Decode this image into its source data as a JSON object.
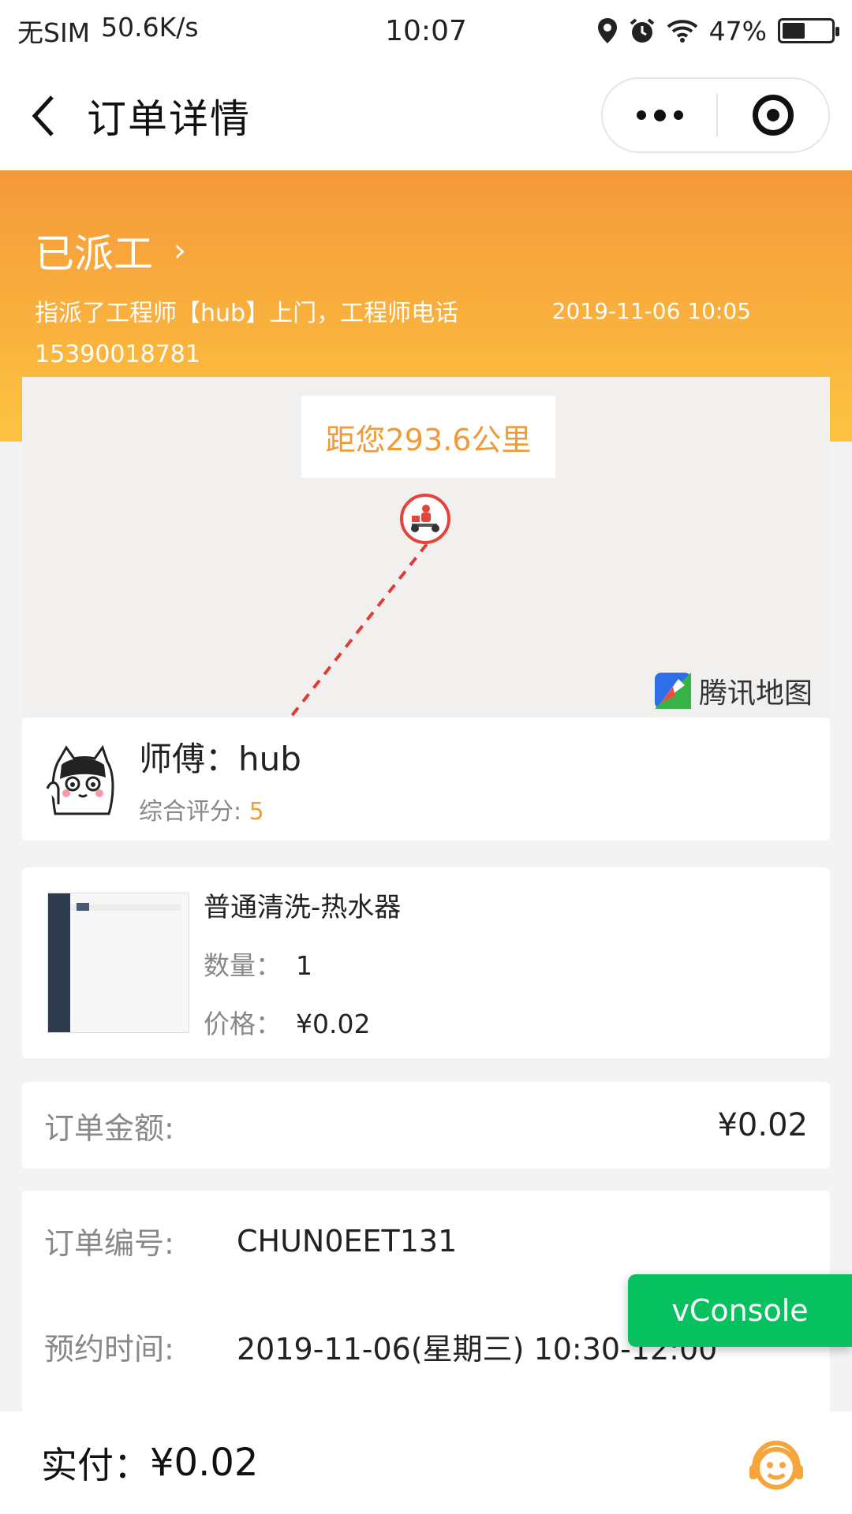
{
  "status_bar": {
    "carrier": "无SIM",
    "speed": "50.6K/s",
    "time": "10:07",
    "battery": "47%",
    "battery_level": 0.47
  },
  "nav": {
    "title": "订单详情",
    "icons": [
      "back-arrow-icon",
      "more-icon",
      "target-icon"
    ]
  },
  "order_status": {
    "title": "已派工",
    "message": "指派了工程师【hub】上门，工程师电话15390018781",
    "time": "2019-11-06 10:05"
  },
  "map": {
    "distance": "距您293.6公里",
    "provider": "腾讯地图",
    "route_color": "#e23b33"
  },
  "worker": {
    "name": "师傅：hub",
    "rating_label": "综合评分: ",
    "rating_value": "5"
  },
  "product": {
    "name": "普通清洗-热水器",
    "quantity_label": "数量：",
    "quantity": "1",
    "price_label": "价格：",
    "price": "¥0.02"
  },
  "amount": {
    "label": "订单金额:",
    "value": "¥0.02"
  },
  "order_info": {
    "number_label": "订单编号:",
    "number": "CHUN0EET131",
    "time_label": "预约时间:",
    "time_value": "2019-11-06(星期三) 10:30-12:00"
  },
  "vconsole": {
    "label": "vConsole"
  },
  "bottom": {
    "paid_label": "实付：",
    "paid_value": "¥0.02"
  },
  "colors": {
    "header_orange": "#f5993a",
    "accent": "#f0a030",
    "vconsole_green": "#07c160"
  }
}
